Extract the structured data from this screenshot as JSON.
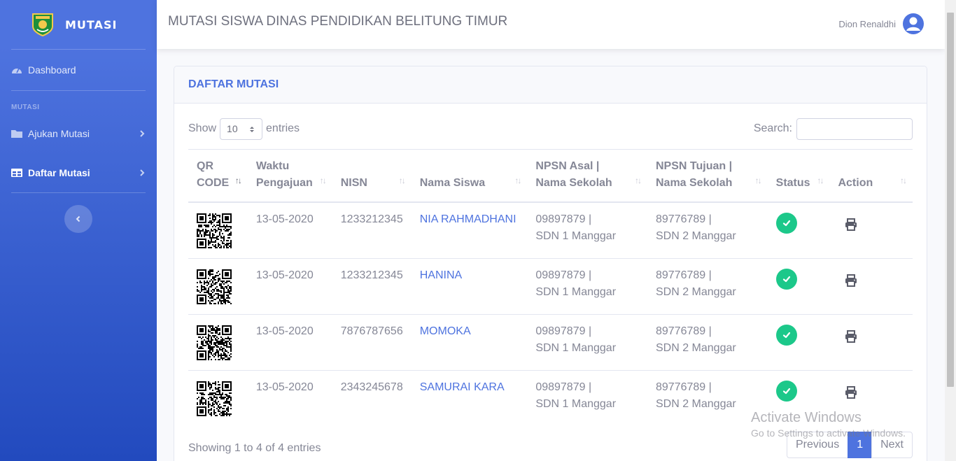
{
  "brand": {
    "name": "MUTASI",
    "logo": "regional-emblem-logo"
  },
  "sidebar": {
    "dashboard": {
      "label": "Dashboard",
      "icon": "dashboard-gauge-icon"
    },
    "heading": "MUTASI",
    "items": [
      {
        "label": "Ajukan Mutasi",
        "icon": "folder-icon",
        "active": false
      },
      {
        "label": "Daftar Mutasi",
        "icon": "table-icon",
        "active": true
      }
    ],
    "toggle_icon": "chevron-left-icon"
  },
  "topbar": {
    "title": "MUTASI SISWA DINAS PENDIDIKAN BELITUNG TIMUR",
    "user_name": "Dion Renaldhi",
    "avatar_icon": "user-circle-icon"
  },
  "card": {
    "title": "DAFTAR MUTASI",
    "show_label": "Show",
    "entries_value": "10",
    "entries_label": "entries",
    "search_label": "Search:",
    "search_value": ""
  },
  "table": {
    "headers": [
      "QR CODE",
      "Waktu Pengajuan",
      "NISN",
      "Nama Siswa",
      "NPSN Asal | Nama Sekolah",
      "NPSN Tujuan | Nama Sekolah",
      "Status",
      "Action"
    ],
    "rows": [
      {
        "waktu": "13-05-2020",
        "nisn": "1233212345",
        "nama": "NIA RAHMADHANI",
        "asal_npsn": "09897879 |",
        "asal_sekolah": "SDN 1 Manggar",
        "tujuan_npsn": "89776789 |",
        "tujuan_sekolah": "SDN 2 Manggar",
        "status": "approved"
      },
      {
        "waktu": "13-05-2020",
        "nisn": "1233212345",
        "nama": "HANINA",
        "asal_npsn": "09897879 |",
        "asal_sekolah": "SDN 1 Manggar",
        "tujuan_npsn": "89776789 |",
        "tujuan_sekolah": "SDN 2 Manggar",
        "status": "approved"
      },
      {
        "waktu": "13-05-2020",
        "nisn": "7876787656",
        "nama": "MOMOKA",
        "asal_npsn": "09897879 |",
        "asal_sekolah": "SDN 1 Manggar",
        "tujuan_npsn": "89776789 |",
        "tujuan_sekolah": "SDN 2 Manggar",
        "status": "approved"
      },
      {
        "waktu": "13-05-2020",
        "nisn": "2343245678",
        "nama": "SAMURAI KARA",
        "asal_npsn": "09897879 |",
        "asal_sekolah": "SDN 1 Manggar",
        "tujuan_npsn": "89776789 |",
        "tujuan_sekolah": "SDN 2 Manggar",
        "status": "approved"
      }
    ]
  },
  "footer": {
    "info": "Showing 1 to 4 of 4 entries",
    "previous": "Previous",
    "page": "1",
    "next": "Next"
  },
  "watermark": {
    "line1": "Activate Windows",
    "line2": "Go to Settings to activate Windows."
  },
  "colors": {
    "primary": "#4e73df",
    "success": "#1cc88a",
    "text": "#858796"
  }
}
